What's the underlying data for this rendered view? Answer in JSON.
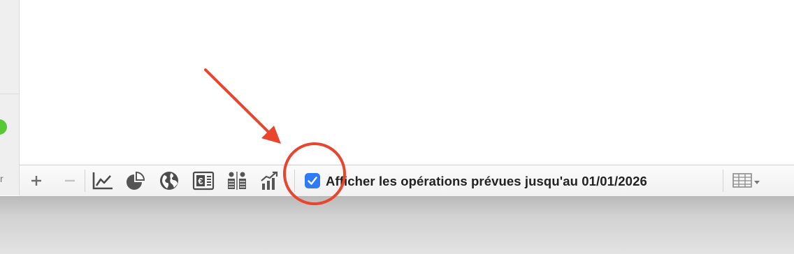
{
  "sidebar": {
    "partial_letter": "r"
  },
  "toolbar": {
    "buttons": [
      {
        "name": "add",
        "icon": "plus-icon"
      },
      {
        "name": "remove",
        "icon": "minus-icon"
      },
      {
        "name": "line-chart",
        "icon": "line-chart-icon"
      },
      {
        "name": "pie-chart",
        "icon": "pie-chart-icon"
      },
      {
        "name": "globe",
        "icon": "globe-icon"
      },
      {
        "name": "euro-statement",
        "icon": "euro-document-icon"
      },
      {
        "name": "compare",
        "icon": "compare-icon"
      },
      {
        "name": "growth-chart",
        "icon": "bar-growth-icon"
      }
    ],
    "checkbox": {
      "checked": true,
      "label": "Afficher les opérations prévues jusqu'au 01/01/2026"
    },
    "table_menu_icon": "table-dropdown-icon"
  },
  "annotation": {
    "arrow_color": "#e8452c",
    "circle_color": "#e8452c"
  },
  "colors": {
    "accent": "#2f7bf6",
    "status_green": "#59c837"
  }
}
